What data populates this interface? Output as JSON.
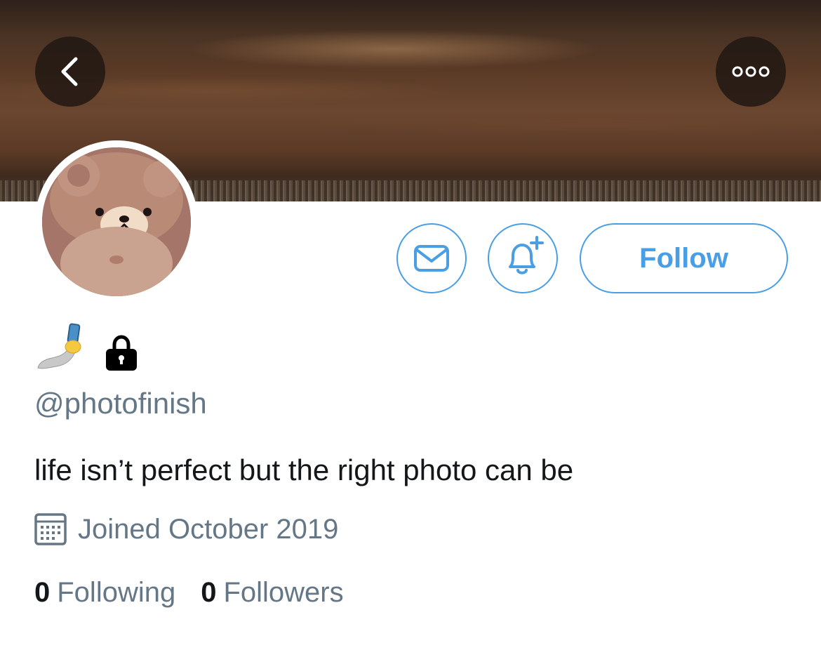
{
  "header": {
    "back_icon": "chevron-left-icon",
    "more_icon": "more-options-icon"
  },
  "profile": {
    "avatar_alt": "avatar",
    "display_name_emoji": [
      "selfie-emoji",
      "lock-icon"
    ],
    "handle": "@photofinish",
    "bio": "life isn’t perfect but the right photo can be",
    "joined": "Joined October 2019",
    "following_count": "0",
    "following_label": "Following",
    "followers_count": "0",
    "followers_label": "Followers"
  },
  "actions": {
    "message_icon": "mail-icon",
    "notify_icon": "bell-plus-icon",
    "follow_label": "Follow"
  },
  "colors": {
    "accent": "#4a9ee3",
    "secondary_text": "#657786",
    "primary_text": "#14171a"
  }
}
